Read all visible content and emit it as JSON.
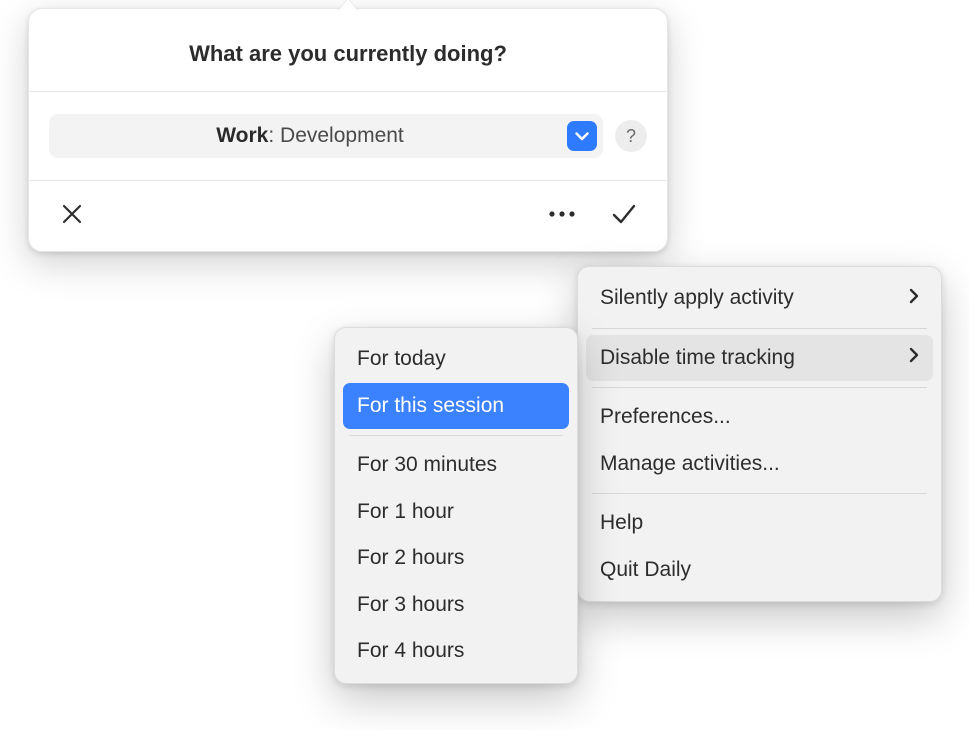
{
  "popover": {
    "title": "What are you currently doing?",
    "select": {
      "category_label": "Work",
      "separator": ": ",
      "value": "Development"
    },
    "help_label": "?"
  },
  "icons": {
    "close": "close-icon",
    "more": "more-icon",
    "confirm": "check-icon",
    "caret": "chevron-down-icon",
    "chevron_right": "〉"
  },
  "main_menu": {
    "items": [
      {
        "label": "Silently apply activity",
        "has_submenu": true,
        "hovered": false
      },
      {
        "label": "Disable time tracking",
        "has_submenu": true,
        "hovered": true
      },
      {
        "label": "Preferences...",
        "has_submenu": false,
        "hovered": false
      },
      {
        "label": "Manage activities...",
        "has_submenu": false,
        "hovered": false
      },
      {
        "label": "Help",
        "has_submenu": false,
        "hovered": false
      },
      {
        "label": "Quit Daily",
        "has_submenu": false,
        "hovered": false
      }
    ]
  },
  "sub_menu": {
    "items": [
      {
        "label": "For today",
        "selected": false
      },
      {
        "label": "For this session",
        "selected": true
      },
      {
        "label": "For 30 minutes",
        "selected": false
      },
      {
        "label": "For 1 hour",
        "selected": false
      },
      {
        "label": "For 2 hours",
        "selected": false
      },
      {
        "label": "For 3 hours",
        "selected": false
      },
      {
        "label": "For 4 hours",
        "selected": false
      }
    ]
  }
}
